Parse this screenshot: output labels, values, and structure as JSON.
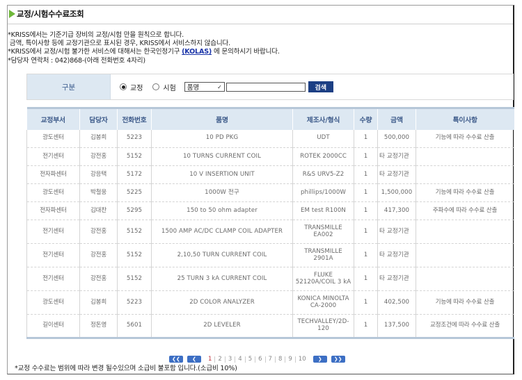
{
  "page": {
    "title": "교정/시험수수료조회",
    "title_icon": "triangle-right-icon"
  },
  "notes": [
    "*KRISS에서는 기준기급 장비의 교정/시험 만을 원칙으로 합니다.",
    " 금액, 특이사항 등에 교정기관으로 표시된 경우, KRISS에서 서비스하지 않습니다.",
    "*KRISS에서 교정/시험 불가한 서비스에 대해서는 한국인정기구 ",
    "*담당자 연락처 : 042)868-(아래 전화번호 4자리)"
  ],
  "kolas_link": "(KOLAS)",
  "notes_line3_suffix": " 에 문의하시기 바랍니다.",
  "search": {
    "label": "구분",
    "radio_calibration": "교정",
    "radio_test": "시험",
    "selected_radio": "교정",
    "select_value": "품명",
    "input_value": "",
    "button_label": "검색"
  },
  "table": {
    "headers": [
      "교정부서",
      "담당자",
      "전화번호",
      "품명",
      "제조사/형식",
      "수량",
      "금액",
      "특이사항"
    ],
    "rows": [
      [
        "광도센터",
        "김봉희",
        "5223",
        "10 PD PKG",
        "UDT",
        "1",
        "500,000",
        "기능에 따라 수수료 산출"
      ],
      [
        "전기센터",
        "강전홍",
        "5152",
        "10 TURNS CURRENT COIL",
        "ROTEK 2000CC",
        "1",
        "타 교정기관",
        ""
      ],
      [
        "전자파센터",
        "강응택",
        "5172",
        "10 V INSERTION UNIT",
        "R&S URV5-Z2",
        "1",
        "타 교정기관",
        ""
      ],
      [
        "광도센터",
        "박철웅",
        "5225",
        "1000W 전구",
        "phillips/1000W",
        "1",
        "1,500,000",
        "기능에 따라 수수료 산출"
      ],
      [
        "전자파센터",
        "김대찬",
        "5295",
        "150 to 50 ohm adapter",
        "EM test R100N",
        "1",
        "417,300",
        "주파수에 따라 수수료 산출"
      ],
      [
        "전기센터",
        "강전홍",
        "5152",
        "1500 AMP AC/DC CLAMP COIL ADAPTER",
        "TRANSMILLE EA002",
        "1",
        "타 교정기관",
        ""
      ],
      [
        "전기센터",
        "강전홍",
        "5152",
        "2,10,50 TURN CURRENT COIL",
        "TRANSMILLE 2901A",
        "1",
        "타 교정기관",
        ""
      ],
      [
        "전기센터",
        "강전홍",
        "5152",
        "25 TURN 3 kA CURRENT COIL",
        "FLUKE 52120A/COIL 3 kA",
        "1",
        "타 교정기관",
        ""
      ],
      [
        "광도센터",
        "김봉희",
        "5223",
        "2D COLOR ANALYZER",
        "KONICA MINOLTA CA-2000",
        "1",
        "402,500",
        "기능에 따라 수수료 산출"
      ],
      [
        "길이센터",
        "정돈영",
        "5601",
        "2D LEVELER",
        "TECHVALLEY/2D-120",
        "1",
        "137,500",
        "교정조건에 따라 수수료 산출"
      ]
    ]
  },
  "pagination": {
    "first_icon": "double-chevron-left-icon",
    "prev_icon": "chevron-left-icon",
    "next_icon": "chevron-right-icon",
    "last_icon": "double-chevron-right-icon",
    "pages": [
      "1",
      "2",
      "3",
      "4",
      "5",
      "6",
      "7",
      "8",
      "9",
      "10"
    ],
    "current": "1"
  },
  "footnote": "*교정 수수료는 범위에 따라 변경 될수있으며 소급비 불포함 입니다.(소급비 10%)",
  "colors": {
    "title_icon": "#6fb83a",
    "header_bg": "#dde8f2",
    "header_text": "#3e5b8a",
    "search_button": "#1c3f84",
    "link": "#1a34a8",
    "pager_button": "#3d6fc4",
    "current_page": "#c0303a"
  }
}
